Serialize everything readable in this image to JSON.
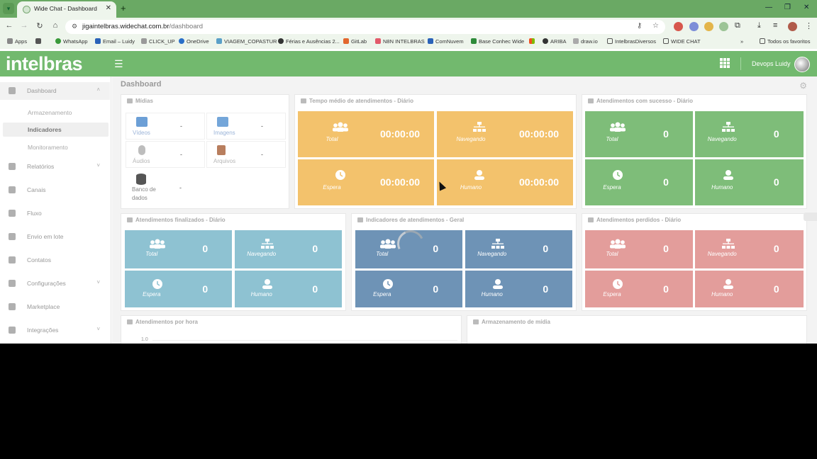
{
  "browser": {
    "tab_title": "Wide Chat - Dashboard",
    "url_host": "jigaintelbras.widechat.com.br",
    "url_path": "/dashboard",
    "bookmarks": [
      "Apps",
      "WhatsApp",
      "Email – Luidy",
      "CLICK_UP",
      "OneDrive",
      "VIAGEM_COPASTUR",
      "Férias e Ausências 2...",
      "GitLab",
      "N8N INTELBRAS",
      "ComNuvem",
      "Base Conhec Wide",
      "ARIBA",
      "draw.io",
      "IntelbrasDiversos",
      "WIDE CHAT"
    ],
    "bookmarks_more": "»",
    "favorites": "Todos os favoritos"
  },
  "header": {
    "logo": "intelbras",
    "user": "Devops Luidy"
  },
  "sidebar": {
    "items": [
      {
        "label": "Dashboard",
        "chev": "˄"
      },
      {
        "label": "Relatórios",
        "chev": "˅"
      },
      {
        "label": "Canais",
        "chev": ""
      },
      {
        "label": "Fluxo",
        "chev": ""
      },
      {
        "label": "Envio em lote",
        "chev": ""
      },
      {
        "label": "Contatos",
        "chev": ""
      },
      {
        "label": "Configurações",
        "chev": "˅"
      },
      {
        "label": "Marketplace",
        "chev": ""
      },
      {
        "label": "Integrações",
        "chev": "˅"
      }
    ],
    "sub": [
      "Armazenamento",
      "Indicadores",
      "Monitoramento"
    ]
  },
  "main": {
    "title": "Dashboard",
    "midias": {
      "title": "Mídias",
      "cells": [
        {
          "label": "Vídeos",
          "value": "-"
        },
        {
          "label": "Imagens",
          "value": "-"
        },
        {
          "label": "Áudios",
          "value": "-"
        },
        {
          "label": "Arquivos",
          "value": "-"
        },
        {
          "label": "Banco de dados",
          "value": "-"
        }
      ]
    },
    "tempo": {
      "title": "Tempo médio de atendimentos - Diário",
      "tiles": [
        {
          "label": "Total",
          "value": "00:00:00"
        },
        {
          "label": "Navegando",
          "value": "00:00:00"
        },
        {
          "label": "Espera",
          "value": "00:00:00"
        },
        {
          "label": "Humano",
          "value": "00:00:00"
        }
      ]
    },
    "sucesso": {
      "title": "Atendimentos com sucesso - Diário",
      "tiles": [
        {
          "label": "Total",
          "value": "0"
        },
        {
          "label": "Navegando",
          "value": "0"
        },
        {
          "label": "Espera",
          "value": "0"
        },
        {
          "label": "Humano",
          "value": "0"
        }
      ]
    },
    "finalizados": {
      "title": "Atendimentos finalizados - Diário",
      "tiles": [
        {
          "label": "Total",
          "value": "0"
        },
        {
          "label": "Navegando",
          "value": "0"
        },
        {
          "label": "Espera",
          "value": "0"
        },
        {
          "label": "Humano",
          "value": "0"
        }
      ]
    },
    "indicadores": {
      "title": "Indicadores de atendimentos - Geral",
      "tiles": [
        {
          "label": "Total",
          "value": "0"
        },
        {
          "label": "Navegando",
          "value": "0"
        },
        {
          "label": "Espera",
          "value": "0"
        },
        {
          "label": "Humano",
          "value": "0"
        }
      ]
    },
    "perdidos": {
      "title": "Atendimentos perdidos - Diário",
      "tiles": [
        {
          "label": "Total",
          "value": "0"
        },
        {
          "label": "Navegando",
          "value": "0"
        },
        {
          "label": "Espera",
          "value": "0"
        },
        {
          "label": "Humano",
          "value": "0"
        }
      ]
    },
    "por_hora": {
      "title": "Atendimentos por hora",
      "tick": "1.0"
    },
    "armazenamento": {
      "title": "Armazenamento de mídia"
    }
  },
  "colors": {
    "header_green": "#72b96e",
    "yellow": "#f3c26c",
    "green": "#7ebd79",
    "blue": "#8ec2d2",
    "slate": "#6e93b6",
    "red": "#e39d9b"
  }
}
